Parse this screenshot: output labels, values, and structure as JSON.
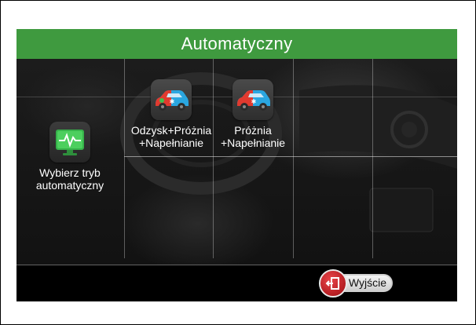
{
  "header": {
    "title": "Automatyczny"
  },
  "modes": [
    {
      "label": "Wybierz tryb\nautomatyczny",
      "icon": "monitor-heartbeat-icon"
    },
    {
      "label": "Odzysk+Próżnia\n+Napełnianie",
      "icon": "car-recovery-icon"
    },
    {
      "label": "Próżnia\n+Napełnianie",
      "icon": "car-vacuum-icon"
    }
  ],
  "footer": {
    "exit_label": "Wyjście",
    "exit_icon": "exit-door-icon"
  },
  "colors": {
    "title_bar": "#3f9a3f",
    "accent_green": "#2fb34a",
    "exit_red": "#c3262b"
  }
}
